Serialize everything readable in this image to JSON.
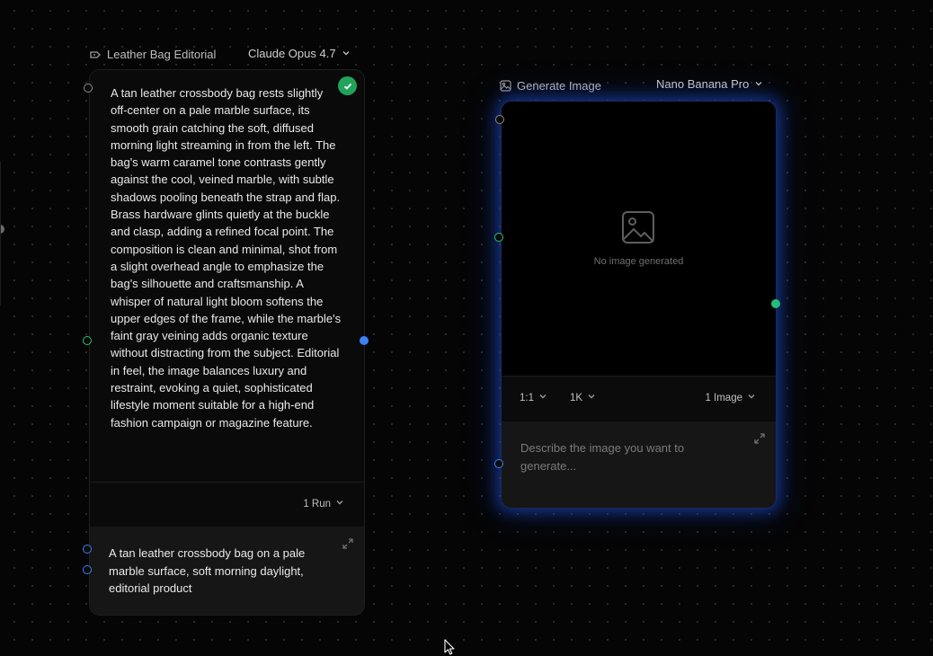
{
  "text_node": {
    "label": "Leather Bag Editorial",
    "model": "Claude Opus 4.7",
    "output_text": "A tan leather crossbody bag rests slightly off-center on a pale marble surface, its smooth grain catching the soft, diffused morning light streaming in from the left. The bag's warm caramel tone contrasts gently against the cool, veined marble, with subtle shadows pooling beneath the strap and flap. Brass hardware glints quietly at the buckle and clasp, adding a refined focal point. The composition is clean and minimal, shot from a slight overhead angle to emphasize the bag's silhouette and craftsmanship. A whisper of natural light bloom softens the upper edges of the frame, while the marble's faint gray veining adds organic texture without distracting from the subject. Editorial in feel, the image balances luxury and restraint, evoking a quiet, sophisticated lifestyle moment suitable for a high-end fashion campaign or magazine feature.",
    "runs": "1 Run",
    "prompt": "A tan leather crossbody bag on a pale marble surface, soft morning daylight, editorial product",
    "status_color": "#22a35a"
  },
  "image_node": {
    "label": "Generate Image",
    "model": "Nano Banana Pro",
    "empty_text": "No image generated",
    "aspect_ratio": "1:1",
    "resolution": "1K",
    "count": "1 Image",
    "prompt_placeholder": "Describe the image you want to generate...",
    "glow_color": "#1d4ed8"
  },
  "icons": [
    "text-node-icon",
    "chevron-down-icon",
    "check-icon",
    "image-node-icon",
    "image-placeholder-icon",
    "expand-icon",
    "cursor-icon"
  ]
}
